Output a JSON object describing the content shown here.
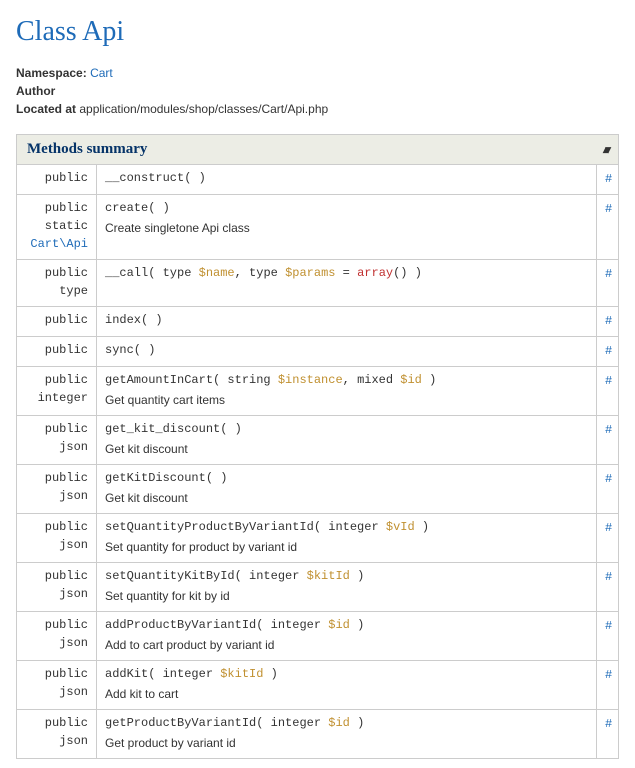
{
  "title": "Class Api",
  "meta": {
    "namespace_label": "Namespace:",
    "namespace_value": "Cart",
    "author_label": "Author",
    "located_label": "Located at",
    "located_value": "application/modules/shop/classes/Cart/Api.php"
  },
  "table_caption": "Methods summary",
  "anchor_symbol": "#",
  "methods": [
    {
      "modifiers": [
        "public"
      ],
      "ret": "",
      "name": "__construct",
      "params": [],
      "desc": ""
    },
    {
      "modifiers": [
        "public",
        "static"
      ],
      "ret": "Cart\\Api",
      "ret_link": true,
      "name": "create",
      "params": [],
      "desc": "Create singletone Api class"
    },
    {
      "modifiers": [
        "public"
      ],
      "ret": "type",
      "name": "__call",
      "params": [
        {
          "type": "type",
          "var": "$name"
        },
        {
          "type": "type",
          "var": "$params",
          "default_kw": "array",
          "default_call": "()"
        }
      ],
      "desc": ""
    },
    {
      "modifiers": [
        "public"
      ],
      "ret": "",
      "name": "index",
      "params": [],
      "desc": ""
    },
    {
      "modifiers": [
        "public"
      ],
      "ret": "",
      "name": "sync",
      "params": [],
      "desc": ""
    },
    {
      "modifiers": [
        "public"
      ],
      "ret": "integer",
      "name": "getAmountInCart",
      "params": [
        {
          "type": "string",
          "var": "$instance"
        },
        {
          "type": "mixed",
          "var": "$id"
        }
      ],
      "desc": "Get quantity cart items"
    },
    {
      "modifiers": [
        "public"
      ],
      "ret": "json",
      "name": "get_kit_discount",
      "params": [],
      "desc": "Get kit discount"
    },
    {
      "modifiers": [
        "public"
      ],
      "ret": "json",
      "name": "getKitDiscount",
      "params": [],
      "desc": "Get kit discount"
    },
    {
      "modifiers": [
        "public"
      ],
      "ret": "json",
      "name": "setQuantityProductByVariantId",
      "params": [
        {
          "type": "integer",
          "var": "$vId"
        }
      ],
      "desc": "Set quantity for product by variant id"
    },
    {
      "modifiers": [
        "public"
      ],
      "ret": "json",
      "name": "setQuantityKitById",
      "params": [
        {
          "type": "integer",
          "var": "$kitId"
        }
      ],
      "desc": "Set quantity for kit by id"
    },
    {
      "modifiers": [
        "public"
      ],
      "ret": "json",
      "name": "addProductByVariantId",
      "params": [
        {
          "type": "integer",
          "var": "$id"
        }
      ],
      "desc": "Add to cart product by variant id"
    },
    {
      "modifiers": [
        "public"
      ],
      "ret": "json",
      "name": "addKit",
      "params": [
        {
          "type": "integer",
          "var": "$kitId"
        }
      ],
      "desc": "Add kit to cart"
    },
    {
      "modifiers": [
        "public"
      ],
      "ret": "json",
      "name": "getProductByVariantId",
      "params": [
        {
          "type": "integer",
          "var": "$id"
        }
      ],
      "desc": "Get product by variant id"
    }
  ]
}
